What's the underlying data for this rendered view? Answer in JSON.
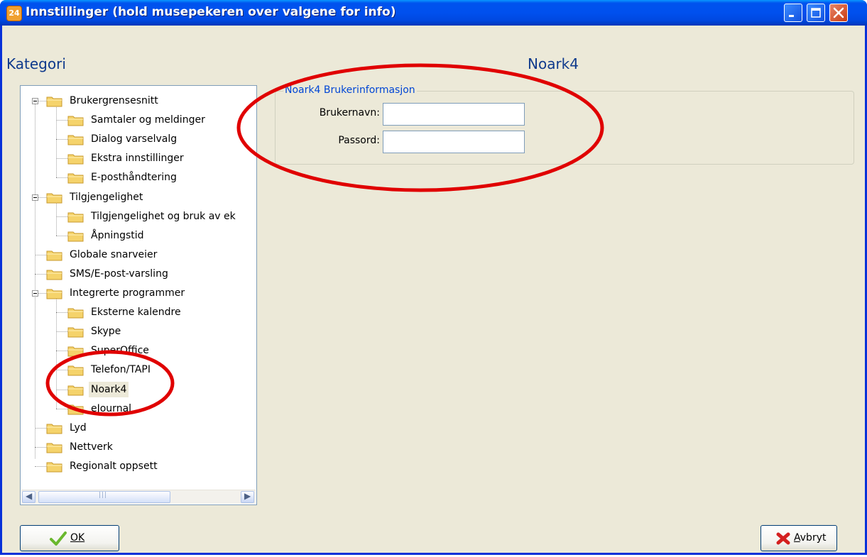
{
  "window": {
    "title": "Innstillinger (hold musepekeren over valgene for info)",
    "app_icon_text": "24"
  },
  "category_label": "Kategori",
  "panel_heading": "Noark4",
  "tree": {
    "items": [
      {
        "label": "Brukergrensesnitt",
        "level": 0,
        "expander": true
      },
      {
        "label": "Samtaler og meldinger",
        "level": 1
      },
      {
        "label": "Dialog varselvalg",
        "level": 1
      },
      {
        "label": "Ekstra innstillinger",
        "level": 1
      },
      {
        "label": "E-posthåndtering",
        "level": 1
      },
      {
        "label": "Tilgjengelighet",
        "level": 0,
        "expander": true
      },
      {
        "label": "Tilgjengelighet og bruk av ek",
        "level": 1
      },
      {
        "label": "Åpningstid",
        "level": 1
      },
      {
        "label": "Globale snarveier",
        "level": 0
      },
      {
        "label": "SMS/E-post-varsling",
        "level": 0
      },
      {
        "label": "Integrerte programmer",
        "level": 0,
        "expander": true
      },
      {
        "label": "Eksterne kalendre",
        "level": 1
      },
      {
        "label": "Skype",
        "level": 1
      },
      {
        "label": "SuperOffice",
        "level": 1
      },
      {
        "label": "Telefon/TAPI",
        "level": 1
      },
      {
        "label": "Noark4",
        "level": 1,
        "selected": true
      },
      {
        "label": "eJournal",
        "level": 1
      },
      {
        "label": "Lyd",
        "level": 0
      },
      {
        "label": "Nettverk",
        "level": 0
      },
      {
        "label": "Regionalt oppsett",
        "level": 0
      }
    ]
  },
  "group": {
    "legend": "Noark4 Brukerinformasjon",
    "username_label": "Brukernavn:",
    "username_value": "",
    "password_label": "Passord:",
    "password_value": ""
  },
  "buttons": {
    "ok_label": "OK",
    "cancel_label": "Avbryt"
  },
  "colors": {
    "heading": "#0f3a8c",
    "legend": "#0046d5",
    "annotation": "#e00000"
  }
}
